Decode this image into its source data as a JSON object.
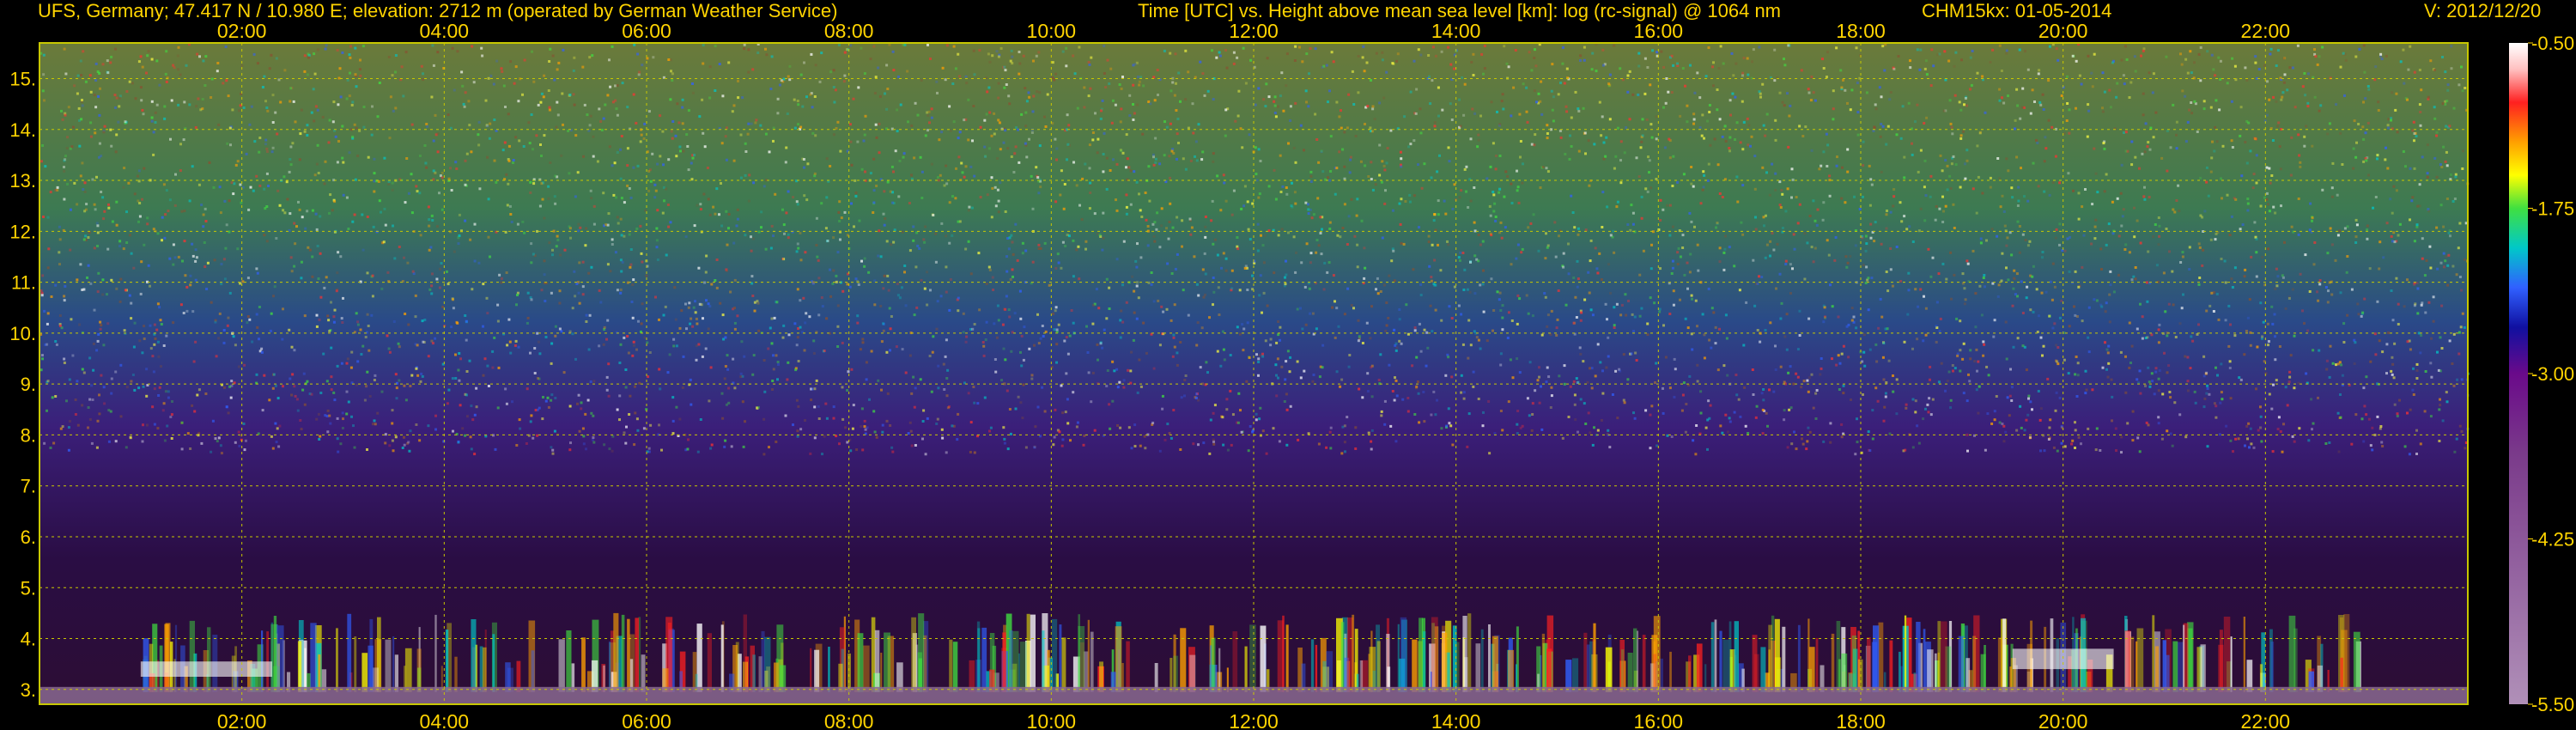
{
  "header": {
    "station": "UFS, Germany; 47.417 N / 10.980 E; elevation: 2712 m  (operated by German Weather Service)",
    "title": "Time [UTC] vs. Height above mean sea level [km]: log (rc-signal) @ 1064 nm",
    "instrument": "CHM15kx: 01-05-2014",
    "version": "V: 2012/12/20"
  },
  "colors": {
    "text": "#ffd400",
    "grid": "#c8c800",
    "background": "#000000"
  },
  "chart_data": {
    "type": "heatmap",
    "title": "Time [UTC] vs. Height above mean sea level [km]: log (rc-signal) @ 1064 nm",
    "xlabel": "",
    "ylabel": "",
    "x_ticks": [
      "02:00",
      "04:00",
      "06:00",
      "08:00",
      "10:00",
      "12:00",
      "14:00",
      "16:00",
      "18:00",
      "20:00",
      "22:00"
    ],
    "x_tick_hours": [
      2,
      4,
      6,
      8,
      10,
      12,
      14,
      16,
      18,
      20,
      22
    ],
    "xlim_hours": [
      0,
      24
    ],
    "y_ticks": [
      "3.",
      "4.",
      "5.",
      "6.",
      "7.",
      "8.",
      "9.",
      "10.",
      "11.",
      "12.",
      "13.",
      "14.",
      "15."
    ],
    "y_tick_values": [
      3,
      4,
      5,
      6,
      7,
      8,
      9,
      10,
      11,
      12,
      13,
      14,
      15
    ],
    "ylim": [
      2.71,
      15.7
    ],
    "grid": true,
    "colorbar": {
      "labels": [
        "-0.50",
        "-1.75",
        "-3.00",
        "-4.25",
        "-5.50"
      ],
      "values": [
        -0.5,
        -1.75,
        -3.0,
        -4.25,
        -5.5
      ],
      "range": [
        -5.5,
        -0.5
      ]
    }
  }
}
